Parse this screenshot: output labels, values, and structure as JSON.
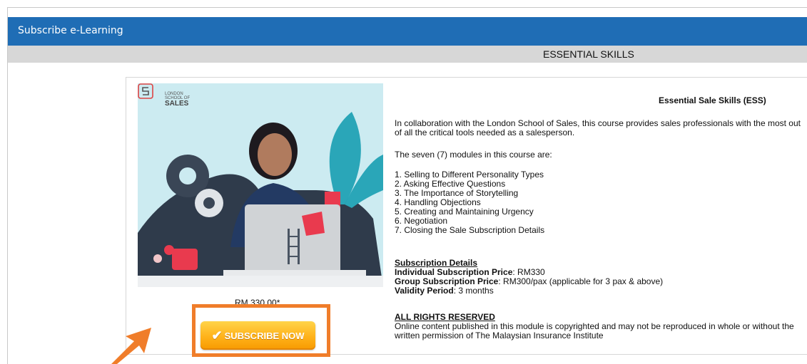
{
  "header": {
    "title": "Subscribe e-Learning"
  },
  "section": {
    "label": "ESSENTIAL SKILLS"
  },
  "course": {
    "logo": {
      "line1": "LONDON",
      "line2": "SCHOOL OF",
      "line3": "SALES"
    },
    "price": "RM 330.00*",
    "subscribe_label": "SUBSCRIBE NOW",
    "title": "Essential Sale Skills (ESS)",
    "intro": "In collaboration with the London School of Sales, this course provides sales professionals with the most out of all the critical tools needed as a salesperson.",
    "modules_lead": "The seven (7) modules in this course are:",
    "modules": [
      "1. Selling to Different Personality Types",
      "2. Asking Effective Questions",
      "3. The Importance of Storytelling",
      "4. Handling Objections",
      "5. Creating and Maintaining Urgency",
      "6. Negotiation",
      "7. Closing the Sale Subscription Details"
    ],
    "subscription": {
      "heading": "Subscription Details",
      "individual_label": "Individual Subscription Price",
      "individual_value": ": RM330",
      "group_label": "Group Subscription Price",
      "group_value": ": RM300/pax (applicable for 3 pax & above)",
      "validity_label": "Validity Period",
      "validity_value": ": 3 months"
    },
    "rights": {
      "heading": "ALL RIGHTS RESERVED",
      "text": "Online content published in this module is copyrighted and may not be reproduced in whole or without the written permission of The Malaysian Insurance Institute"
    }
  },
  "colors": {
    "header_bg": "#1f6db5",
    "section_bg": "#d7d7d7",
    "highlight": "#f07d2a",
    "button": "#ffb21a"
  },
  "icons": {
    "check": "checkmark-icon",
    "arrow": "pointer-arrow-icon",
    "logo": "london-school-of-sales-logo"
  }
}
